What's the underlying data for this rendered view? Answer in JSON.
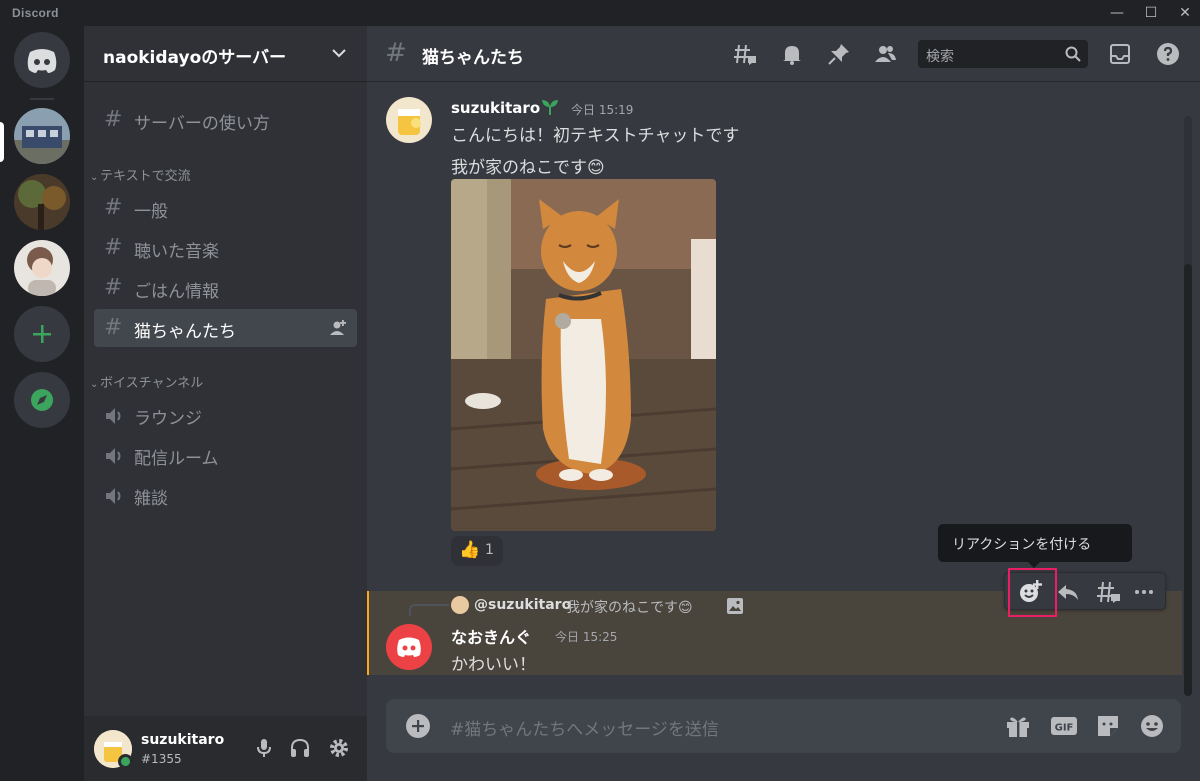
{
  "window": {
    "app_title": "Discord"
  },
  "server": {
    "name": "naokidayoのサーバー"
  },
  "channels": {
    "top": {
      "name": "サーバーの使い方"
    },
    "text_category": "テキストで交流",
    "text": [
      {
        "name": "一般"
      },
      {
        "name": "聴いた音楽"
      },
      {
        "name": "ごはん情報"
      },
      {
        "name": "猫ちゃんたち"
      }
    ],
    "voice_category": "ボイスチャンネル",
    "voice": [
      {
        "name": "ラウンジ"
      },
      {
        "name": "配信ルーム"
      },
      {
        "name": "雑談"
      }
    ]
  },
  "user": {
    "name": "suzukitaro",
    "tag": "#1355"
  },
  "header": {
    "channel": "猫ちゃんたち",
    "search_placeholder": "検索"
  },
  "messages": [
    {
      "author": "suzukitaro",
      "time": "今日 15:19",
      "lines": [
        "こんにちは！初テキストチャットです",
        "我が家のねこです😊"
      ],
      "reaction": {
        "emoji": "👍",
        "count": "1"
      }
    },
    {
      "reply_to": {
        "author": "@suzukitaro",
        "text": "我が家のねこです😊"
      },
      "author": "なおきんぐ",
      "time": "今日 15:25",
      "text": "かわいい！"
    }
  ],
  "tooltip": "リアクションを付ける",
  "composer": {
    "placeholder": "#猫ちゃんたちへメッセージを送信"
  },
  "colors": {
    "accent": "#5865f2",
    "online": "#3ba55d",
    "highlight_bar": "#faa81a",
    "focus_box": "#e91e63"
  }
}
